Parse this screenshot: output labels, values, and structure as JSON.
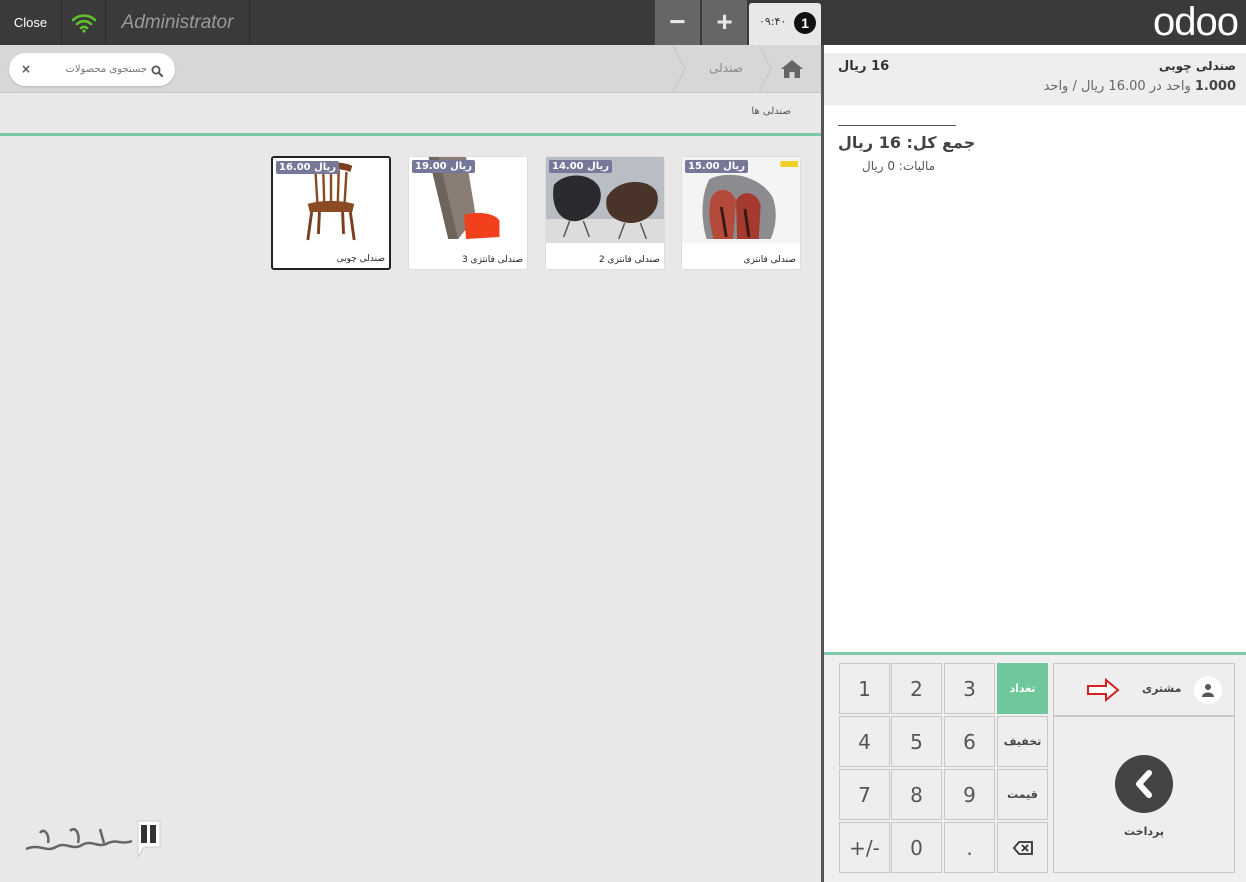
{
  "topbar": {
    "close_label": "Close",
    "user_name": "Administrator",
    "minus_label": "−",
    "plus_label": "+",
    "order_time": "۰۹:۴۰",
    "order_number": "1",
    "logo": "odoo"
  },
  "breadcrumb": {
    "category": "صندلی"
  },
  "search": {
    "placeholder": "جستجوی محصولات",
    "clear": "×"
  },
  "category_title": "صندلی ها",
  "products": [
    {
      "name": "صندلی فانتزی",
      "price": "15.00 ریال"
    },
    {
      "name": "صندلی فانتزی 2",
      "price": "14.00 ریال"
    },
    {
      "name": "صندلی فانتزی 3",
      "price": "19.00 ریال"
    },
    {
      "name": "صندلی چوبی",
      "price": "16.00 ریال"
    }
  ],
  "order": {
    "line_name": "صندلی چوبی",
    "line_price": "16 ریال",
    "line_qty": "1.000",
    "line_unit_info": "واحد در 16.00 ریال / واحد",
    "total": "جمع کل: 16 ریال",
    "tax": "مالیات: 0 ریال"
  },
  "numpad": {
    "keys": [
      "1",
      "2",
      "3",
      "4",
      "5",
      "6",
      "7",
      "8",
      "9",
      "+/-",
      "0",
      "."
    ],
    "mode_qty": "تعداد",
    "mode_disc": "تخفیف",
    "mode_price": "قیمت"
  },
  "actions": {
    "customer": "مشتری",
    "payment": "پرداخت"
  },
  "colors": {
    "accent_green": "#7ac8a6",
    "topbar": "#3a3a3a",
    "price_badge": "#777799",
    "wifi": "#5ec22d",
    "arrow_red": "#d32020"
  }
}
